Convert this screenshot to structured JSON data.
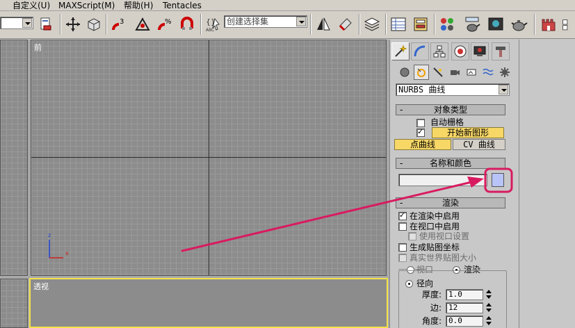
{
  "menubar": {
    "items": [
      "自定义(U)",
      "MAXScript(M)",
      "帮助(H)",
      "Tentacles"
    ]
  },
  "toolbar": {
    "selection_set_placeholder": "创建选择集",
    "filter_combo_value": "",
    "abc_label": "ABC"
  },
  "viewports": {
    "front_label": "前",
    "persp_label": "透视",
    "axis_z": "z",
    "axis_x": "x"
  },
  "panel": {
    "category_dropdown": "NURBS 曲线",
    "object_type": {
      "title": "对象类型",
      "collapse": "-",
      "autogrid_label": "自动栅格",
      "autogrid_checked": false,
      "start_new_shape_checked": true,
      "start_new_shape_label": "开始新图形",
      "point_curve_label": "点曲线",
      "cv_curve_label": "CV 曲线"
    },
    "name_color": {
      "title": "名称和颜色",
      "collapse": "-",
      "name_value": "",
      "swatch_color": "#b8c4f8"
    },
    "rendering": {
      "title": "渲染",
      "collapse": "-",
      "enable_in_renderer": "在渲染中启用",
      "enable_in_viewport": "在视口中启用",
      "use_viewport_settings": "使用视口设置",
      "generate_mapping": "生成贴图坐标",
      "real_world_map": "真实世界贴图大小",
      "viewport_radio": "视口",
      "render_radio": "渲染",
      "radial": "径向",
      "thickness_label": "厚度:",
      "thickness_value": "1.0",
      "sides_label": "边:",
      "sides_value": "12",
      "angle_label": "角度:",
      "angle_value": "0.0"
    }
  },
  "colors": {
    "highlight": "#d81b60",
    "perspective_border": "#f4e24a",
    "active_button": "#f7d766"
  }
}
